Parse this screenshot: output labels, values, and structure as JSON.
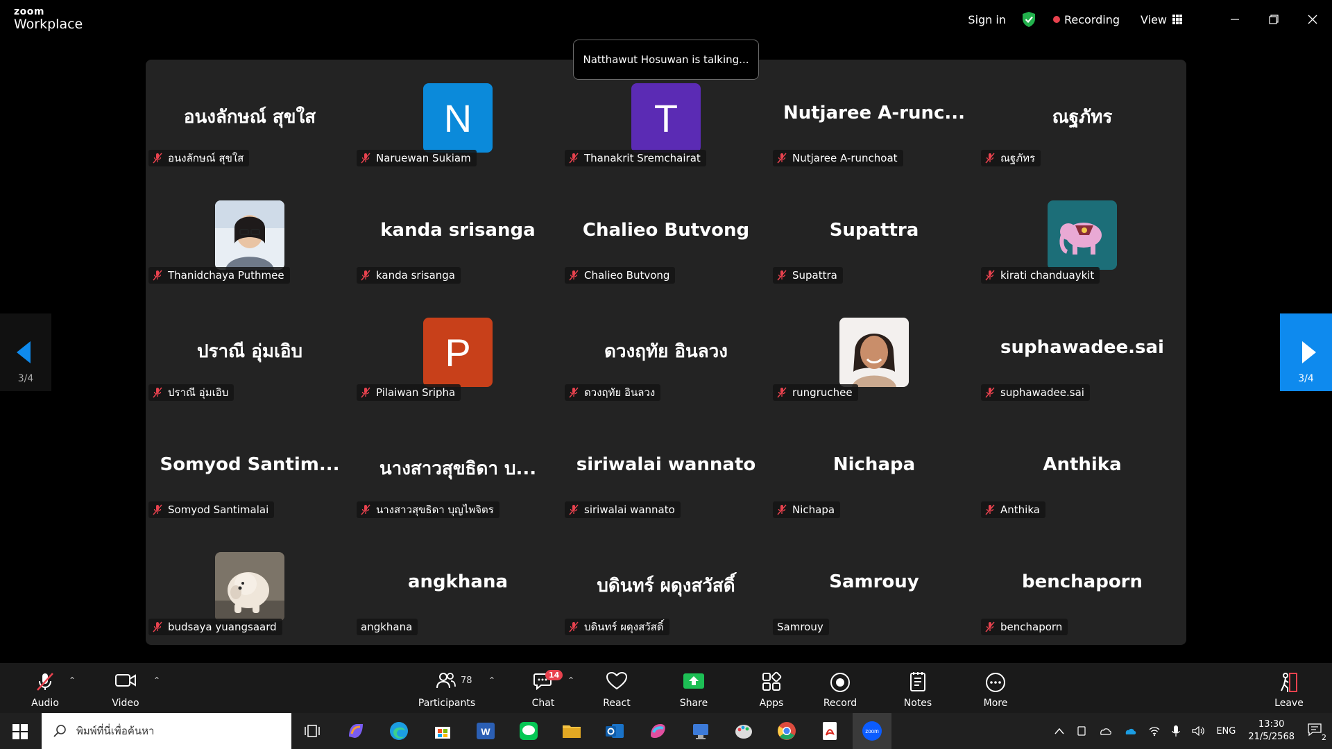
{
  "app": {
    "logo_top": "zoom",
    "logo_bottom": "Workplace",
    "sign_in": "Sign in",
    "recording": "Recording",
    "view": "View"
  },
  "talking": "Natthawut Hosuwan is talking...",
  "paging": {
    "left": "3/4",
    "right": "3/4"
  },
  "tiles": [
    {
      "big": "อนงลักษณ์  สุขใส",
      "label": "อนงลักษณ์  สุขใส",
      "muted": true
    },
    {
      "avatar": "N",
      "avatar_color": "#0b8ada",
      "label": "Naruewan Sukiam",
      "muted": true
    },
    {
      "avatar": "T",
      "avatar_color": "#5b2bb4",
      "label": "Thanakrit Sremchairat",
      "muted": true
    },
    {
      "big": "Nutjaree  A-runc...",
      "label": "Nutjaree A-runchoat",
      "muted": true
    },
    {
      "big": "ณฐภัทร",
      "label": "ณฐภัทร",
      "muted": true
    },
    {
      "photo": "woman-glasses-photo",
      "label": "Thanidchaya Puthmee",
      "muted": true
    },
    {
      "big": "kanda srisanga",
      "label": "kanda srisanga",
      "muted": true
    },
    {
      "big": "Chalieo Butvong",
      "label": "Chalieo Butvong",
      "muted": true
    },
    {
      "big": "Supattra",
      "label": "Supattra",
      "muted": true
    },
    {
      "photo": "elephant-photo",
      "label": "kirati chanduaykit",
      "muted": true
    },
    {
      "big": "ปราณี  อุ่มเอิบ",
      "label": "ปราณี  อุ่มเอิบ",
      "muted": true
    },
    {
      "avatar": "P",
      "avatar_color": "#c8401a",
      "label": "Pilaiwan Sripha",
      "muted": true
    },
    {
      "big": "ดวงฤทัย  อินลวง",
      "label": "ดวงฤทัย  อินลวง",
      "muted": true
    },
    {
      "photo": "woman-smiling-photo",
      "label": "rungruchee",
      "muted": true
    },
    {
      "big": "suphawadee.sai",
      "label": "suphawadee.sai",
      "muted": true
    },
    {
      "big": "Somyod  Santim...",
      "label": "Somyod Santimalai",
      "muted": true
    },
    {
      "big": "นางสาวสุขธิดา  บ...",
      "label": "นางสาวสุขธิดา  บุญไพจิตร",
      "muted": true
    },
    {
      "big": "siriwalai wannato",
      "label": "siriwalai wannato",
      "muted": true
    },
    {
      "big": "Nichapa",
      "label": "Nichapa",
      "muted": true
    },
    {
      "big": "Anthika",
      "label": "Anthika",
      "muted": true
    },
    {
      "photo": "dog-photo",
      "label": "budsaya yuangsaard",
      "muted": true
    },
    {
      "big": "angkhana",
      "label": "angkhana",
      "muted": false
    },
    {
      "big": "บดินทร์ ผดุงสวัสดิ์",
      "label": "บดินทร์ ผดุงสวัสดิ์",
      "muted": true
    },
    {
      "big": "Samrouy",
      "label": "Samrouy",
      "muted": false
    },
    {
      "big": "benchaporn",
      "label": "benchaporn",
      "muted": true
    }
  ],
  "toolbar": {
    "audio": "Audio",
    "video": "Video",
    "participants": "Participants",
    "participants_count": "78",
    "chat": "Chat",
    "chat_badge": "14",
    "react": "React",
    "share": "Share",
    "apps": "Apps",
    "record": "Record",
    "notes": "Notes",
    "more": "More",
    "leave": "Leave"
  },
  "taskbar": {
    "search_placeholder": "พิมพ์ที่นี่เพื่อค้นหา",
    "lang": "ENG",
    "time": "13:30",
    "date": "21/5/2568",
    "notif_count": "2"
  },
  "colors": {
    "accent": "#0e8aee",
    "muted_red": "#e8424e",
    "share_green": "#1dbf55",
    "shield_green": "#22b14c"
  }
}
